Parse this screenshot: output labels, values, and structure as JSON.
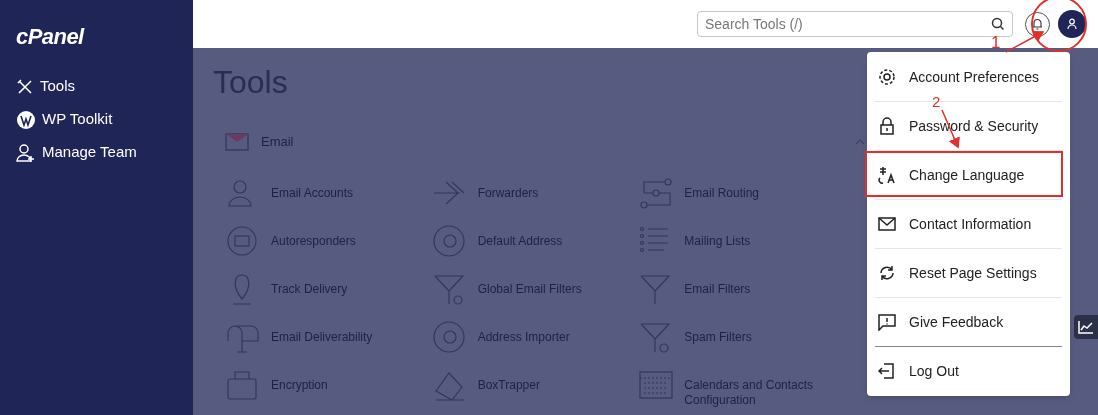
{
  "sidebar": {
    "logo": "cPanel",
    "items": [
      {
        "label": "Tools",
        "selected": false
      },
      {
        "label": "WP Toolkit",
        "selected": false
      },
      {
        "label": "Manage Team",
        "selected": false
      }
    ]
  },
  "header": {
    "search": {
      "placeholder": "Search Tools (/)"
    }
  },
  "main": {
    "title": "Tools",
    "section": {
      "title": "Email",
      "expanded": true,
      "tools": [
        {
          "label": "Email Accounts"
        },
        {
          "label": "Forwarders"
        },
        {
          "label": "Email Routing"
        },
        {
          "label": "Autoresponders"
        },
        {
          "label": "Default Address"
        },
        {
          "label": "Mailing Lists"
        },
        {
          "label": "Track Delivery"
        },
        {
          "label": "Global Email Filters"
        },
        {
          "label": "Email Filters"
        },
        {
          "label": "Email Deliverability"
        },
        {
          "label": "Address Importer"
        },
        {
          "label": "Spam Filters"
        },
        {
          "label": "Encryption"
        },
        {
          "label": "BoxTrapper"
        },
        {
          "label": "Calendars and Contacts Configuration"
        }
      ]
    }
  },
  "user_menu": {
    "items": [
      {
        "label": "Account Preferences"
      },
      {
        "label": "Password & Security"
      },
      {
        "label": "Change Language"
      },
      {
        "label": "Contact Information"
      },
      {
        "label": "Reset Page Settings"
      },
      {
        "label": "Give Feedback"
      },
      {
        "label": "Log Out"
      }
    ]
  },
  "annotations": [
    {
      "label": "1"
    },
    {
      "label": "2"
    }
  ]
}
